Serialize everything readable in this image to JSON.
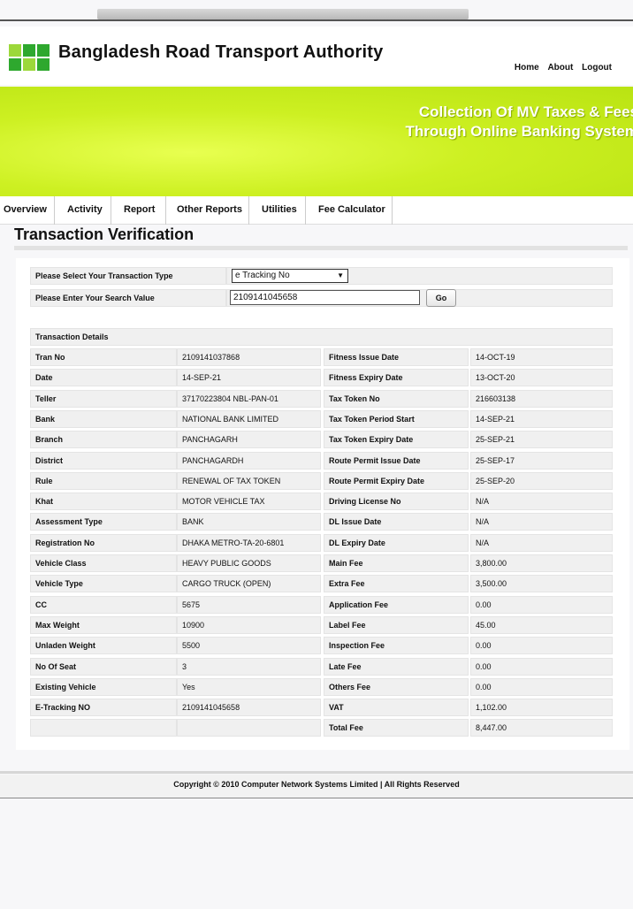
{
  "header": {
    "site_title": "Bangladesh Road Transport Authority",
    "nav": [
      "Home",
      "About",
      "Logout"
    ]
  },
  "banner": {
    "line1": "Collection Of MV Taxes & Fees",
    "line2": "Through Online Banking System"
  },
  "menu": [
    "Overview",
    "Activity",
    "Report",
    "Other Reports",
    "Utilities",
    "Fee Calculator"
  ],
  "page_title": "Transaction Verification",
  "search": {
    "type_label": "Please Select Your Transaction Type",
    "type_value": "e Tracking No",
    "value_label": "Please Enter Your Search Value",
    "value": "2109141045658",
    "go_label": "Go"
  },
  "details": {
    "heading": "Transaction Details",
    "rows": [
      {
        "l1": "Tran No",
        "v1": "2109141037868",
        "l2": "Fitness Issue Date",
        "v2": "14-OCT-19"
      },
      {
        "l1": "Date",
        "v1": "14-SEP-21",
        "l2": "Fitness Expiry Date",
        "v2": "13-OCT-20"
      },
      {
        "l1": "Teller",
        "v1": "37170223804 NBL-PAN-01",
        "l2": "Tax Token No",
        "v2": "216603138"
      },
      {
        "l1": "Bank",
        "v1": "NATIONAL BANK LIMITED",
        "l2": "Tax Token Period Start",
        "v2": "14-SEP-21"
      },
      {
        "l1": "Branch",
        "v1": "PANCHAGARH",
        "l2": "Tax Token Expiry Date",
        "v2": "25-SEP-21"
      },
      {
        "l1": "District",
        "v1": "PANCHAGARDH",
        "l2": "Route Permit Issue Date",
        "v2": "25-SEP-17"
      },
      {
        "l1": "Rule",
        "v1": "RENEWAL OF TAX TOKEN",
        "l2": "Route Permit Expiry Date",
        "v2": "25-SEP-20"
      },
      {
        "l1": "Khat",
        "v1": "MOTOR VEHICLE TAX",
        "l2": "Driving License No",
        "v2": "N/A"
      },
      {
        "l1": "Assessment Type",
        "v1": "BANK",
        "l2": "DL Issue Date",
        "v2": "N/A"
      },
      {
        "l1": "Registration No",
        "v1": "DHAKA METRO-TA-20-6801",
        "l2": "DL Expiry Date",
        "v2": "N/A"
      },
      {
        "l1": "Vehicle Class",
        "v1": "HEAVY PUBLIC GOODS",
        "l2": "Main Fee",
        "v2": "3,800.00"
      },
      {
        "l1": "Vehicle Type",
        "v1": "CARGO TRUCK (OPEN)",
        "l2": "Extra Fee",
        "v2": "3,500.00"
      },
      {
        "l1": "CC",
        "v1": "5675",
        "l2": "Application Fee",
        "v2": "0.00"
      },
      {
        "l1": "Max Weight",
        "v1": "10900",
        "l2": "Label Fee",
        "v2": "45.00"
      },
      {
        "l1": "Unladen Weight",
        "v1": "5500",
        "l2": "Inspection Fee",
        "v2": "0.00"
      },
      {
        "l1": "No Of Seat",
        "v1": "3",
        "l2": "Late Fee",
        "v2": "0.00"
      },
      {
        "l1": "Existing Vehicle",
        "v1": "Yes",
        "l2": "Others Fee",
        "v2": "0.00"
      },
      {
        "l1": "E-Tracking NO",
        "v1": "2109141045658",
        "l2": "VAT",
        "v2": "1,102.00"
      },
      {
        "l1": "",
        "v1": "",
        "l2": "Total Fee",
        "v2": "8,447.00"
      }
    ]
  },
  "footer": "Copyright © 2010 Computer Network Systems Limited | All Rights Reserved",
  "colors": {
    "banner_green": "#cdf022",
    "logo_light": "#9cd83a",
    "logo_dark": "#2ea82e"
  }
}
